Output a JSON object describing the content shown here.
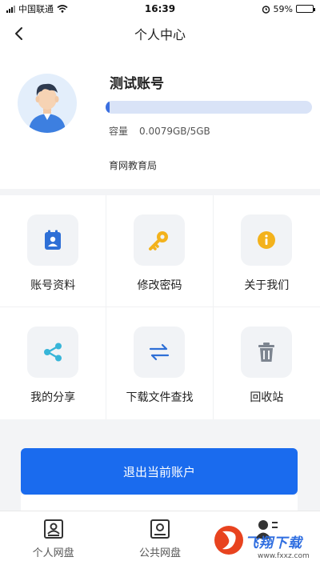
{
  "status_bar": {
    "carrier": "中国联通",
    "time": "16:39",
    "battery_percent": "59%",
    "battery_level": 0.59
  },
  "nav": {
    "title": "个人中心"
  },
  "profile": {
    "username": "测试账号",
    "capacity_label": "容量",
    "capacity_value": "0.0079GB/5GB",
    "usage_fraction": 0.0016,
    "organization": "育网教育局"
  },
  "menu": [
    {
      "label": "账号资料",
      "icon": "id-card-icon",
      "color": "#2e6fd6"
    },
    {
      "label": "修改密码",
      "icon": "key-icon",
      "color": "#f3b21c"
    },
    {
      "label": "关于我们",
      "icon": "info-icon",
      "color": "#f3b21c"
    },
    {
      "label": "我的分享",
      "icon": "share-icon",
      "color": "#37b5d8"
    },
    {
      "label": "下载文件查找",
      "icon": "swap-arrows-icon",
      "color": "#2e6fd6"
    },
    {
      "label": "回收站",
      "icon": "trash-icon",
      "color": "#7d8590"
    }
  ],
  "logout_label": "退出当前账户",
  "tabs": [
    {
      "label": "个人网盘",
      "icon": "personal-drive-icon"
    },
    {
      "label": "公共网盘",
      "icon": "public-drive-icon"
    },
    {
      "label": "",
      "icon": "profile-tab-icon"
    }
  ],
  "watermark": {
    "text": "飞翔下载",
    "url": "www.fxxz.com"
  },
  "colors": {
    "primary": "#1a6bee",
    "progress_track": "#d9e3f7",
    "background": "#f3f4f6"
  }
}
